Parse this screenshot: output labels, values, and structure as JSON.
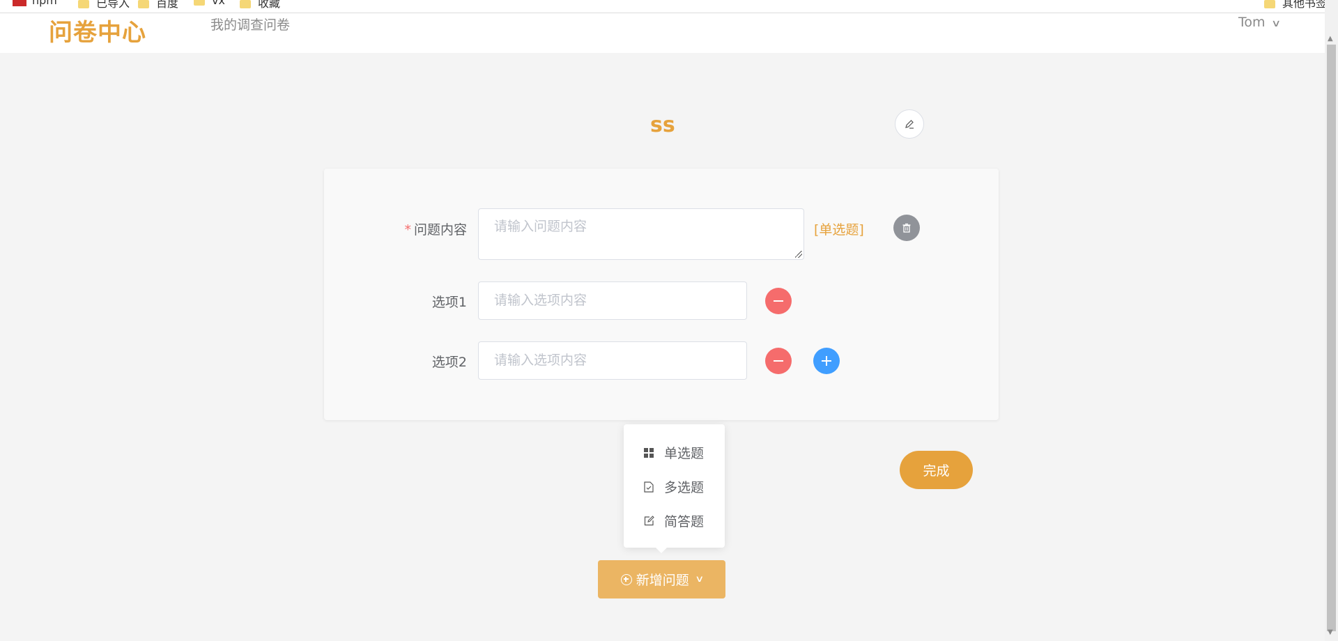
{
  "browser": {
    "bookmarks": [
      "npm",
      "已导入",
      "百度",
      "vx",
      "收藏"
    ],
    "other_bookmarks": "其他书签"
  },
  "header": {
    "logo": "问卷中心",
    "nav_link": "我的调查问卷",
    "user": "Tom"
  },
  "survey": {
    "title": "ss"
  },
  "question": {
    "content_label": "问题内容",
    "content_placeholder": "请输入问题内容",
    "type_tag": "[单选题]",
    "options": [
      {
        "label": "选项1",
        "placeholder": "请输入选项内容"
      },
      {
        "label": "选项2",
        "placeholder": "请输入选项内容"
      }
    ]
  },
  "add_menu": {
    "items": [
      {
        "label": "单选题",
        "icon": "grid-icon"
      },
      {
        "label": "多选题",
        "icon": "checked-document-icon"
      },
      {
        "label": "简答题",
        "icon": "edit-icon"
      }
    ],
    "button_label": "新增问题"
  },
  "done_label": "完成",
  "colors": {
    "accent": "#e6a23c",
    "danger": "#f56c6c",
    "primary": "#409eff",
    "info": "#909399"
  }
}
